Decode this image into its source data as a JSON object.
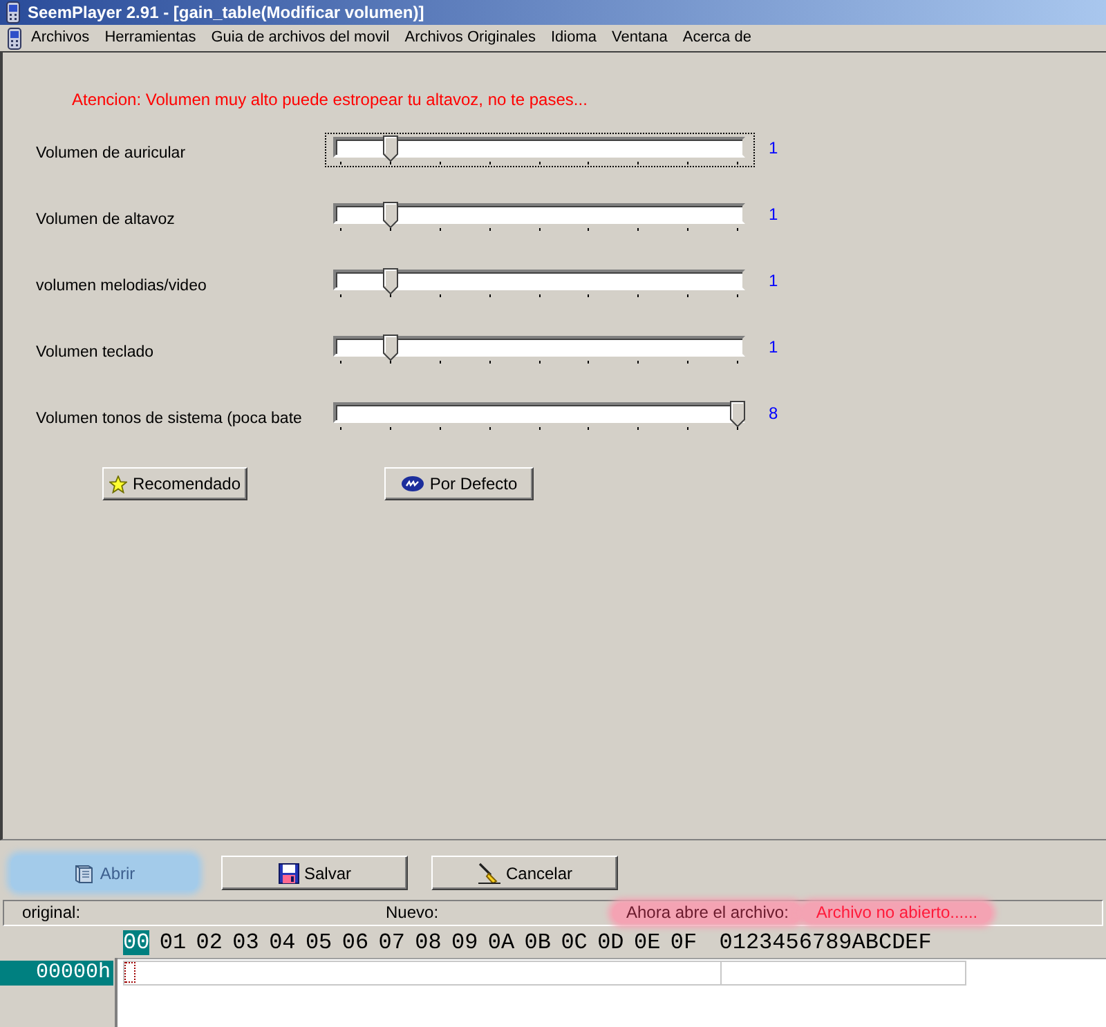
{
  "window": {
    "title": "SeemPlayer 2.91 - [gain_table(Modificar volumen)]"
  },
  "menu": [
    "Archivos",
    "Herramientas",
    "Guia de archivos del movil",
    "Archivos Originales",
    "Idioma",
    "Ventana",
    "Acerca de"
  ],
  "warning": "Atencion: Volumen muy alto puede estropear tu altavoz, no te pases...",
  "sliders": [
    {
      "label": "Volumen de auricular",
      "level": 0.125,
      "reading": "1",
      "focused": true
    },
    {
      "label": "Volumen de altavoz",
      "level": 0.125,
      "reading": "1",
      "focused": false
    },
    {
      "label": "volumen melodias/video",
      "level": 0.125,
      "reading": "1",
      "focused": false
    },
    {
      "label": "Volumen teclado",
      "level": 0.125,
      "reading": "1",
      "focused": false
    },
    {
      "label": "Volumen tonos de sistema (poca bate",
      "level": 1,
      "reading": "8",
      "focused": false
    }
  ],
  "preset_buttons": [
    {
      "label": "Recomendado",
      "kind": "star"
    },
    {
      "label": "Por Defecto",
      "kind": "logo"
    }
  ],
  "action_buttons": [
    {
      "label": "Abrir",
      "kind": "book",
      "highlighted": true
    },
    {
      "label": "Salvar",
      "kind": "disk",
      "highlighted": false
    },
    {
      "label": "Cancelar",
      "kind": "broom",
      "highlighted": false
    }
  ],
  "status_bar": [
    {
      "text": "original:",
      "kind": "label",
      "highlighted": false
    },
    {
      "text": "Nuevo:",
      "kind": "label",
      "highlighted": false
    },
    {
      "text": "Ahora abre el archivo:",
      "kind": "label",
      "highlighted": true
    },
    {
      "text": "Archivo no abierto......",
      "kind": "error",
      "highlighted": true
    }
  ],
  "hex_view": {
    "columns": [
      {
        "label": "00",
        "selected": true
      },
      {
        "label": "01",
        "selected": false
      },
      {
        "label": "02",
        "selected": false
      },
      {
        "label": "03",
        "selected": false
      },
      {
        "label": "04",
        "selected": false
      },
      {
        "label": "05",
        "selected": false
      },
      {
        "label": "06",
        "selected": false
      },
      {
        "label": "07",
        "selected": false
      },
      {
        "label": "08",
        "selected": false
      },
      {
        "label": "09",
        "selected": false
      },
      {
        "label": "0A",
        "selected": false
      },
      {
        "label": "0B",
        "selected": false
      },
      {
        "label": "0C",
        "selected": false
      },
      {
        "label": "0D",
        "selected": false
      },
      {
        "label": "0E",
        "selected": false
      },
      {
        "label": "0F",
        "selected": false
      }
    ],
    "ascii_header": "0123456789ABCDEF",
    "rows": [
      {
        "address": "00000h",
        "selected": true
      }
    ]
  }
}
